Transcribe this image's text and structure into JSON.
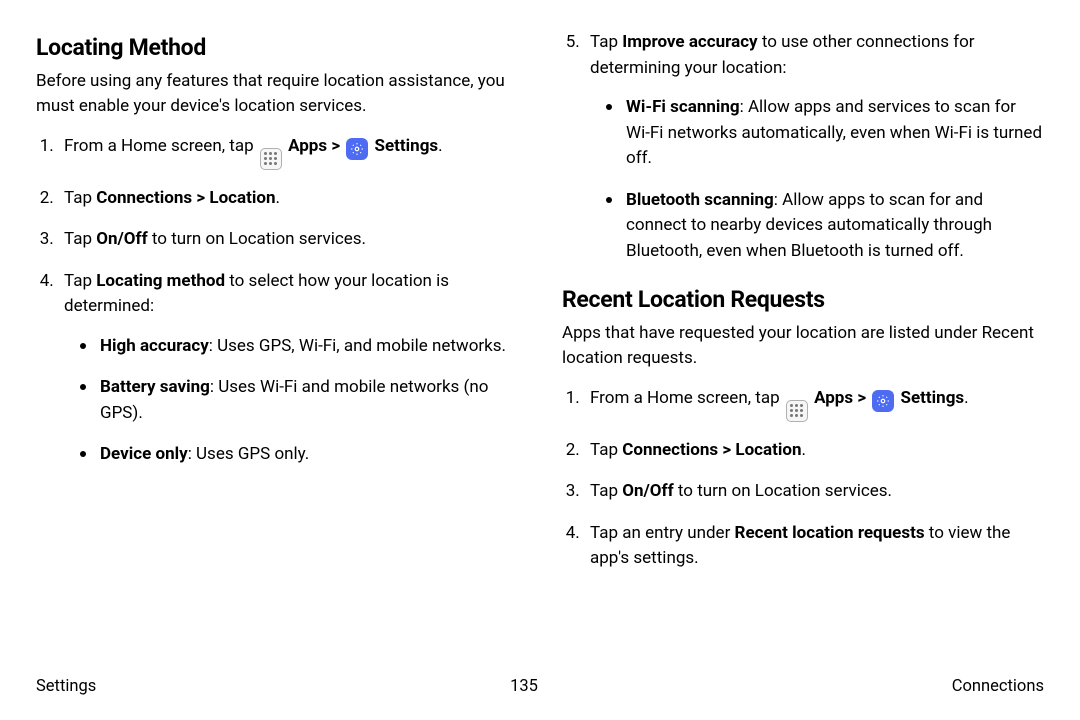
{
  "left": {
    "heading": "Locating Method",
    "intro": "Before using any features that require location assistance, you must enable your device's location services.",
    "step1_pre": "From a Home screen, tap ",
    "apps_label": "Apps",
    "settings_label": "Settings",
    "step2_tap": "Tap ",
    "step2_bold": "Connections > Location",
    "step3_pre": "Tap ",
    "step3_bold": "On/Off",
    "step3_post": " to turn on Location services.",
    "step4_pre": "Tap ",
    "step4_bold": "Locating method",
    "step4_post": " to select how your location is determined:",
    "m1_b": "High accuracy",
    "m1_t": ": Uses GPS, Wi-Fi, and mobile networks.",
    "m2_b": "Battery saving",
    "m2_t": ": Uses Wi-Fi and mobile networks (no GPS).",
    "m3_b": "Device only",
    "m3_t": ": Uses GPS only."
  },
  "right": {
    "step5_pre": "Tap ",
    "step5_bold": "Improve accuracy",
    "step5_post": " to use other connections for determining your location:",
    "s1_b": "Wi-Fi scanning",
    "s1_t": ": Allow apps and services to scan for Wi-Fi networks automatically, even when Wi-Fi is turned off.",
    "s2_b": "Bluetooth scanning",
    "s2_t": ": Allow apps to scan for and connect to nearby devices automatically through Bluetooth, even when Bluetooth is turned off.",
    "heading2": "Recent Location Requests",
    "intro2": "Apps that have requested your location are listed under Recent location requests.",
    "r1_pre": "From a Home screen, tap ",
    "r2_tap": "Tap ",
    "r2_bold": "Connections > Location",
    "r3_pre": "Tap ",
    "r3_bold": "On/Off",
    "r3_post": " to turn on Location services.",
    "r4_pre": "Tap an entry under ",
    "r4_bold": "Recent location requests",
    "r4_post": " to view the app's settings."
  },
  "footer": {
    "left": "Settings",
    "center": "135",
    "right": "Connections"
  },
  "common": {
    "chevron": ">",
    "period": "."
  }
}
